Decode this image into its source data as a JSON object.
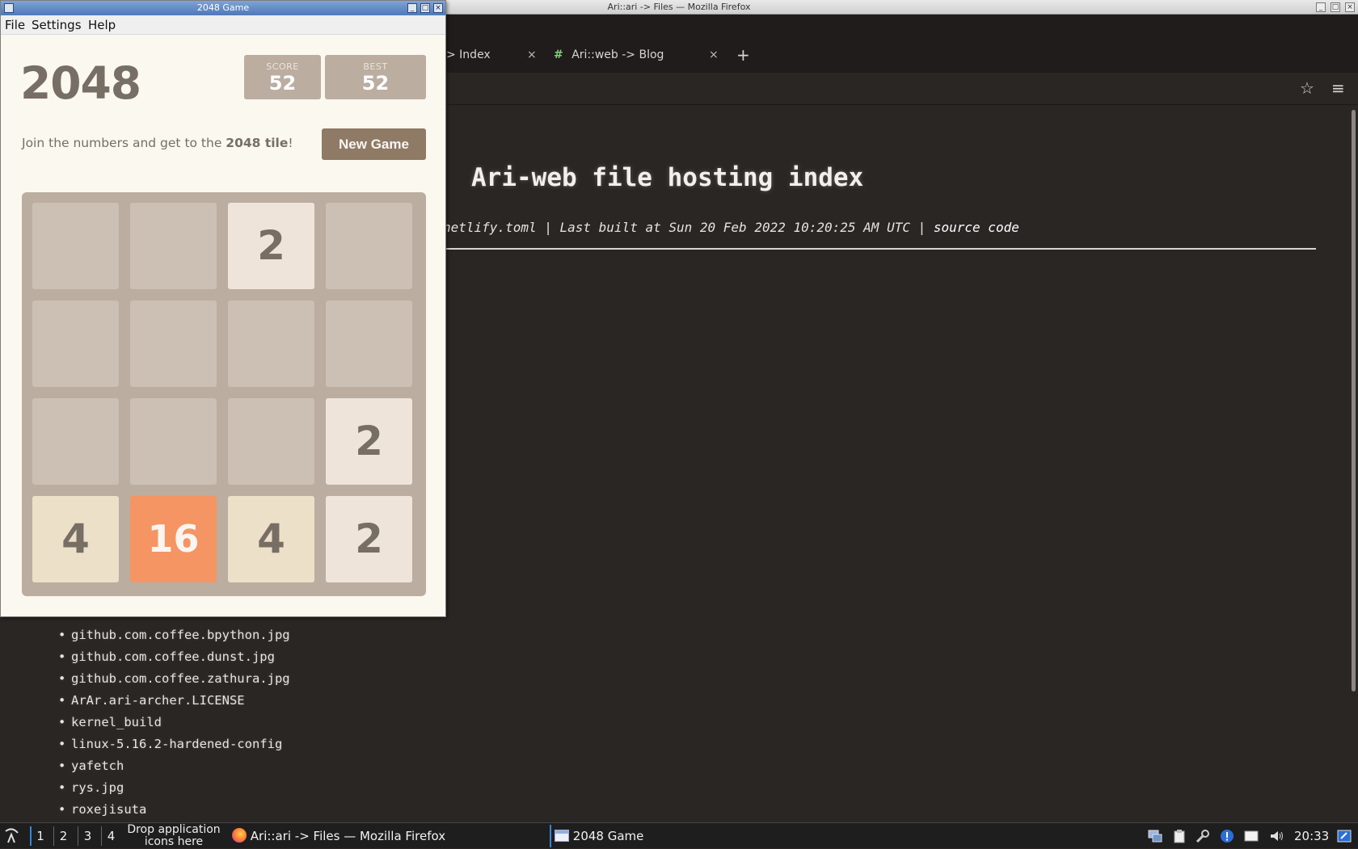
{
  "firefox": {
    "title": "Ari::ari -> Files — Mozilla Firefox",
    "tabs": [
      {
        "label": "> Index"
      },
      {
        "label": "Ari::web -> Blog"
      }
    ],
    "new_tab_label": "+",
    "tab_close_glyph": "×",
    "menu_glyph": "≡",
    "star_glyph": "☆",
    "page": {
      "heading": "Ari-web file hosting index",
      "meta_prefix": "netlify.toml | Last built at Sun 20 Feb 2022 10:20:25 AM UTC | ",
      "meta_link": "source code",
      "files": [
        "github.com.coffee.bpython.jpg",
        "github.com.coffee.dunst.jpg",
        "github.com.coffee.zathura.jpg",
        "ArAr.ari-archer.LICENSE",
        "kernel_build",
        "linux-5.16.2-hardened-config",
        "yafetch",
        "rys.jpg",
        "roxejisuta"
      ]
    }
  },
  "game": {
    "window_title": "2048 Game",
    "menu": [
      "File",
      "Settings",
      "Help"
    ],
    "title": "2048",
    "score_label": "SCORE",
    "score": "52",
    "best_label": "BEST",
    "best": "52",
    "intro_prefix": "Join the numbers and get to the ",
    "intro_bold": "2048 tile",
    "intro_suffix": "!",
    "new_game_label": "New Game",
    "grid": [
      [
        null,
        null,
        2,
        null
      ],
      [
        null,
        null,
        null,
        null
      ],
      [
        null,
        null,
        null,
        2
      ],
      [
        4,
        16,
        4,
        2
      ]
    ],
    "tile_colors": {
      "2": {
        "bg": "#eee4da",
        "fg": "#776e65"
      },
      "4": {
        "bg": "#ede0c8",
        "fg": "#776e65"
      },
      "16": {
        "bg": "#f59563",
        "fg": "#f9f6f2"
      }
    }
  },
  "taskbar": {
    "desktops": [
      "1",
      "2",
      "3",
      "4"
    ],
    "drop_label": "Drop application icons here",
    "tasks": [
      {
        "label": "Ari::ari -> Files — Mozilla Firefox",
        "icon": "firefox-icon"
      },
      {
        "label": "2048 Game",
        "icon": "window-icon"
      }
    ],
    "clock": "20:33"
  }
}
